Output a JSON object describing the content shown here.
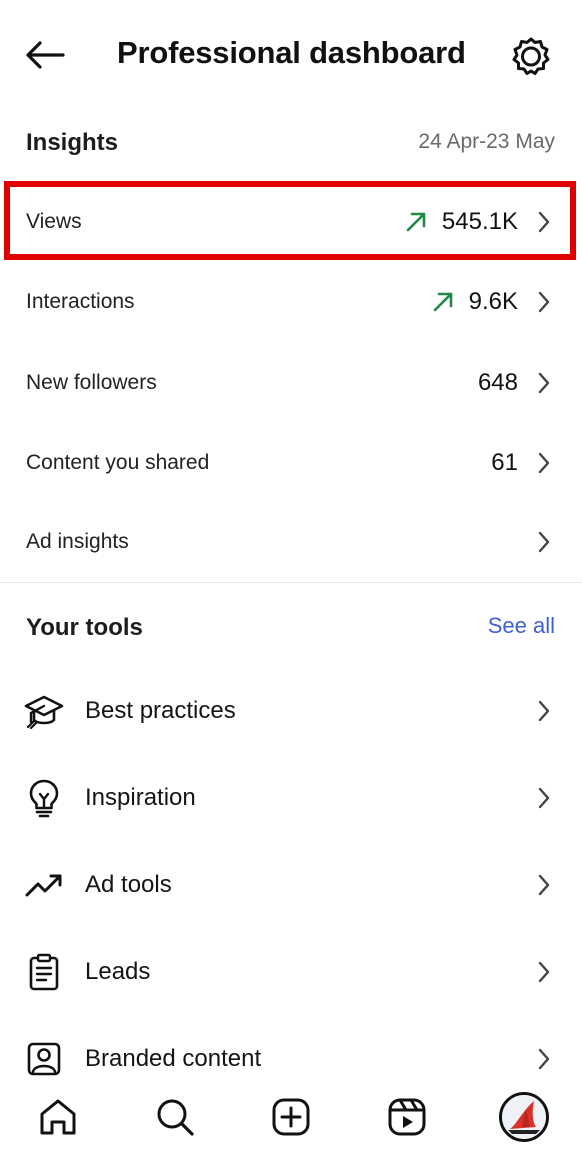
{
  "header": {
    "title": "Professional dashboard",
    "back_icon": "arrow-left-icon",
    "settings_icon": "gear-icon"
  },
  "insights": {
    "title": "Insights",
    "date_range": "24 Apr-23 May",
    "rows": [
      {
        "label": "Views",
        "value": "545.1K",
        "trend": "up",
        "highlighted": true
      },
      {
        "label": "Interactions",
        "value": "9.6K",
        "trend": "up",
        "highlighted": false
      },
      {
        "label": "New followers",
        "value": "648",
        "trend": "none",
        "highlighted": false
      },
      {
        "label": "Content you shared",
        "value": "61",
        "trend": "none",
        "highlighted": false
      },
      {
        "label": "Ad insights",
        "value": "",
        "trend": "none",
        "highlighted": false
      }
    ]
  },
  "tools": {
    "title": "Your tools",
    "see_all": "See all",
    "items": [
      {
        "label": "Best practices",
        "icon": "graduation-cap-icon"
      },
      {
        "label": "Inspiration",
        "icon": "lightbulb-icon"
      },
      {
        "label": "Ad tools",
        "icon": "trend-line-icon"
      },
      {
        "label": "Leads",
        "icon": "clipboard-icon"
      },
      {
        "label": "Branded content",
        "icon": "branded-content-icon"
      }
    ]
  },
  "bottom_nav": {
    "items": [
      "home-icon",
      "search-icon",
      "create-icon",
      "reels-icon",
      "profile-avatar"
    ]
  },
  "colors": {
    "trend_up": "#1e8a46",
    "highlight": "#e00000",
    "link": "#3f5fd6",
    "muted_text": "#6a6a6a"
  }
}
